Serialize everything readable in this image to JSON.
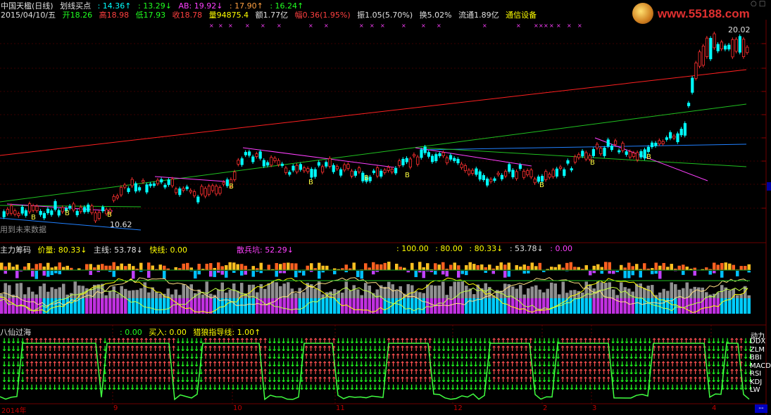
{
  "header": {
    "stock": "中国天楹(日线)",
    "indicator": "划线买点",
    "v1": ": 14.36↑",
    "v2": ": 13.29↓",
    "ab": "AB: 19.92↓",
    "v3": ": 17.90↑",
    "v4": ": 16.24↑"
  },
  "info": {
    "date": "2015/04/10/五",
    "open": "开18.26",
    "high": "高18.98",
    "low": "低17.93",
    "close": "收18.78",
    "volume": "量94875.4",
    "amount": "额1.77亿",
    "change": "幅0.36(1.95%)",
    "amplitude": "振1.05(5.70%)",
    "turnover": "换5.02%",
    "float": "流通1.89亿",
    "sector": "通信设备"
  },
  "logo": {
    "url": "www.55188.com"
  },
  "price_labels": {
    "peak": "20.02",
    "low": "10.62",
    "future_note": "用到未来数据",
    "b_marker": "B"
  },
  "panel2": {
    "title": "主力筹码",
    "price_qty": "价量: 80.33↓",
    "main": "主线: 53.78↓",
    "fast": "快线: 0.00",
    "retail": "散兵坑: 52.29↓",
    "extra1": ": 100.00",
    "extra2": ": 80.00",
    "extra3": ": 80.33↓",
    "extra4": ": 53.78↓",
    "extra5": ": 0.00"
  },
  "panel3": {
    "title": "八仙过海",
    "v1": ": 0.00",
    "buy": "买入: 0.00",
    "hunt": "猎狼指导线: 1.00↑",
    "right_labels": [
      "DDX",
      "ZLM",
      "BBI",
      "MACD",
      "RSI",
      "KDJ",
      "LW"
    ],
    "top_label": "动力"
  },
  "x_axis": {
    "labels": [
      "2014年",
      "9",
      "10",
      "11",
      "12",
      "2",
      "3",
      "4"
    ]
  },
  "colors": {
    "up": "#ff3030",
    "down": "#00ffff",
    "ma_red": "#ff2020",
    "ma_green": "#20c020",
    "ma_blue": "#2080ff",
    "magenta": "#ff40ff"
  }
}
